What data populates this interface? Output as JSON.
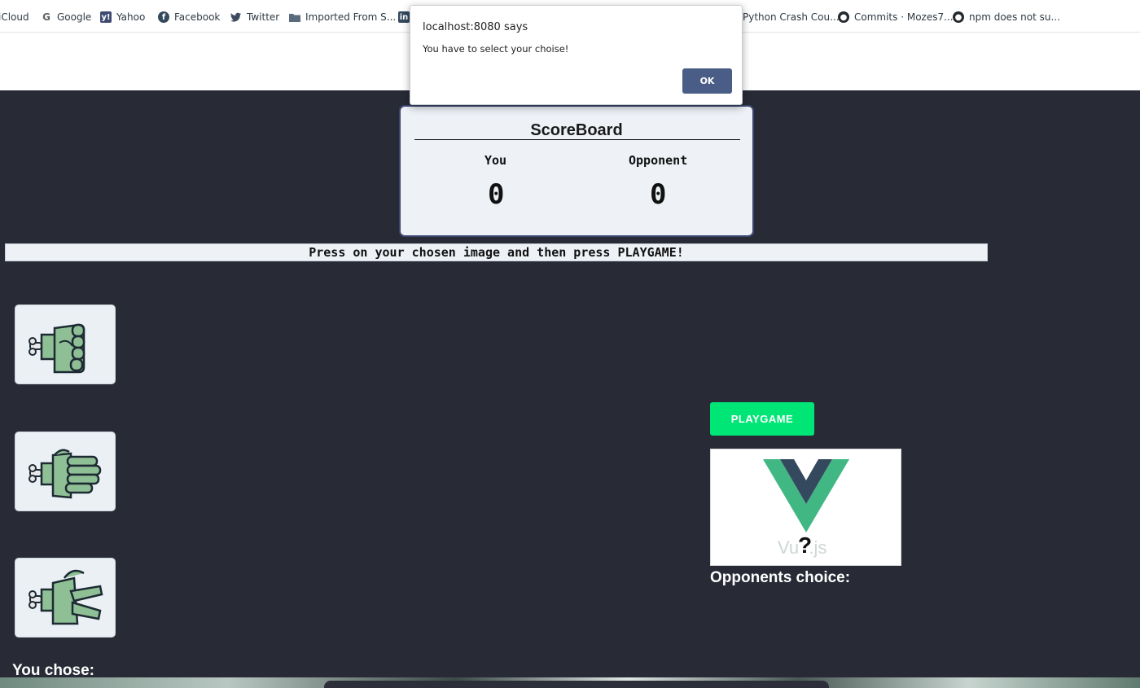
{
  "bookmarks": [
    {
      "label": "iCloud",
      "icon": "icloud-icon"
    },
    {
      "label": "Google",
      "icon": "google-icon"
    },
    {
      "label": "Yahoo",
      "icon": "yahoo-icon"
    },
    {
      "label": "Facebook",
      "icon": "facebook-icon"
    },
    {
      "label": "Twitter",
      "icon": "twitter-icon"
    },
    {
      "label": "Imported From S...",
      "icon": "folder-icon"
    },
    {
      "label": "Python Crash Cou...",
      "icon": "bookmark-icon"
    },
    {
      "label": "Commits · Mozes7...",
      "icon": "github-icon"
    },
    {
      "label": "npm does not su...",
      "icon": "github-icon"
    }
  ],
  "alert": {
    "title": "localhost:8080 says",
    "message": "You have to select your choise!",
    "ok_label": "OK"
  },
  "scoreboard": {
    "title": "ScoreBoard",
    "you_label": "You",
    "opponent_label": "Opponent",
    "you_score": "0",
    "opponent_score": "0"
  },
  "instruction": "Press on your chosen image and then press PLAYGAME!",
  "choices": [
    {
      "name": "rock",
      "icon": "rock-fist-hand-icon"
    },
    {
      "name": "paper",
      "icon": "paper-open-hand-icon"
    },
    {
      "name": "scissors",
      "icon": "scissors-two-finger-hand-icon"
    }
  ],
  "you_chose_label": "You chose:",
  "play_button_label": "PLAYGAME",
  "opponent_image": {
    "logo": "vue-logo",
    "text_left": "Vu",
    "mark": "?",
    "text_right": ".js"
  },
  "opponents_choice_label": "Opponents choice:",
  "colors": {
    "page_bg": "#282b36",
    "play_button": "#00e676",
    "alert_button": "#4a5d86",
    "vue_green": "#41b883",
    "vue_dark": "#35495e"
  }
}
